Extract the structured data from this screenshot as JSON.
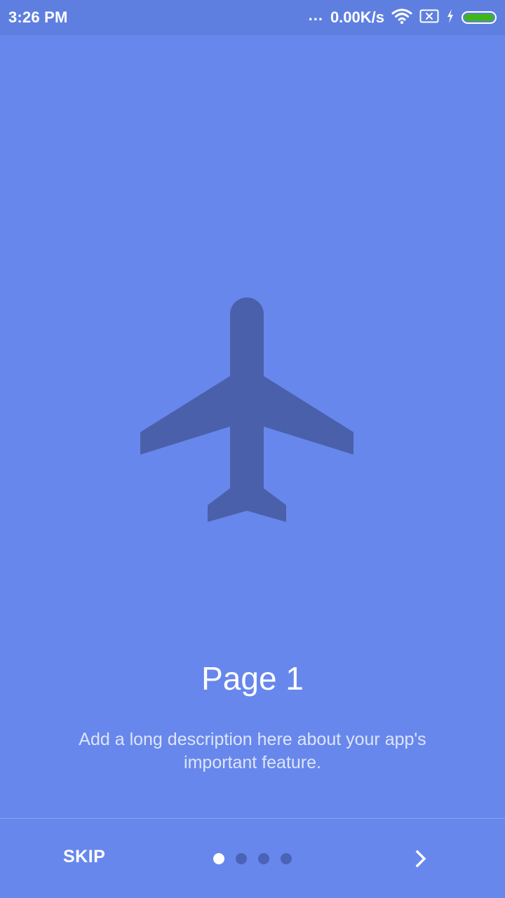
{
  "status_bar": {
    "time": "3:26 PM",
    "dots": "...",
    "network_speed": "0.00K/s",
    "icons": [
      "wifi-icon",
      "sim-x-icon",
      "charging-icon",
      "battery-icon"
    ],
    "battery_color": "#3fb618"
  },
  "slide": {
    "illustration": "airplane-icon",
    "illustration_color": "#4a60aa",
    "title": "Page 1",
    "description": "Add a long description here about your app's important feature."
  },
  "footer": {
    "skip_label": "SKIP",
    "pager": {
      "total": 4,
      "current": 1
    },
    "next_icon": "chevron-right-icon"
  },
  "colors": {
    "background": "#6787ec",
    "status_bar": "#5f7fe0",
    "dot_active": "#ffffff",
    "dot_inactive": "#4b63b7"
  }
}
